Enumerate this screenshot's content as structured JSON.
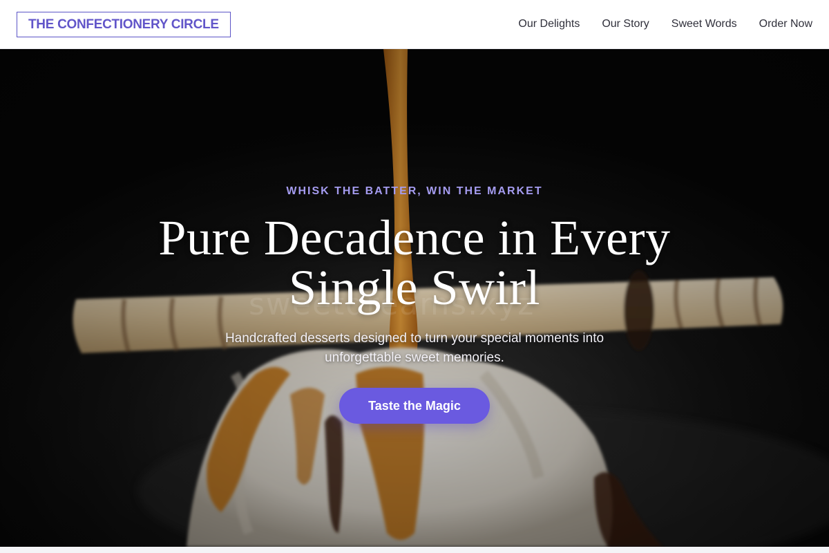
{
  "header": {
    "logo_text": "THE CONFECTIONERY CIRCLE",
    "nav": [
      {
        "label": "Our Delights"
      },
      {
        "label": "Our Story"
      },
      {
        "label": "Sweet Words"
      },
      {
        "label": "Order Now"
      }
    ]
  },
  "hero": {
    "eyebrow": "WHISK THE BATTER, WIN THE MARKET",
    "headline": "Pure Decadence in Every Single Swirl",
    "subtext": "Handcrafted desserts designed to turn your special moments into unforgettable sweet memories.",
    "cta_label": "Taste the Magic",
    "watermark": "sweetdreams.xyz"
  },
  "colors": {
    "brand_purple": "#6a5ae0",
    "eyebrow_lavender": "#a59cf0",
    "caramel": "#c77a1e",
    "background_dark": "#0a0a0a"
  }
}
